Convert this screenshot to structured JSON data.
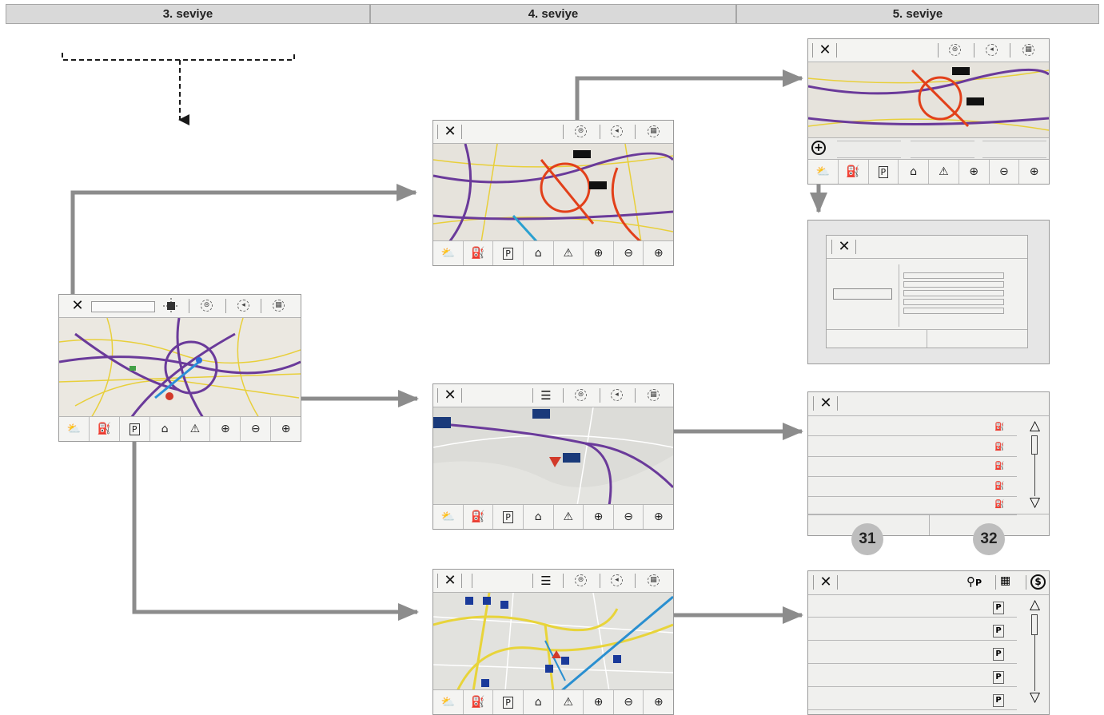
{
  "headers": {
    "level3": "3. seviye",
    "level4": "4. seviye",
    "level5": "5. seviye"
  },
  "icons": {
    "close": "close-icon",
    "weather": "weather-icon",
    "fuel": "fuel-icon",
    "parking": "parking-icon",
    "dealer": "dealer-icon",
    "warning": "warning-icon",
    "zoom_in": "zoom-in-icon",
    "zoom_out": "zoom-out-icon",
    "list": "list-icon",
    "sort_distance": "sort-distance-icon",
    "sort_price": "sort-price-icon"
  },
  "glyphs": {
    "close": "✕",
    "list": "☰",
    "scroll_up": "△",
    "scroll_down": "▽",
    "parking": "P"
  },
  "callouts": {
    "left": "31",
    "right": "32"
  },
  "colors": {
    "arrow": "#8c8c8c",
    "route": "#5a2a8c",
    "traffic": "#e2401a",
    "roads": "#e8cf3a"
  }
}
